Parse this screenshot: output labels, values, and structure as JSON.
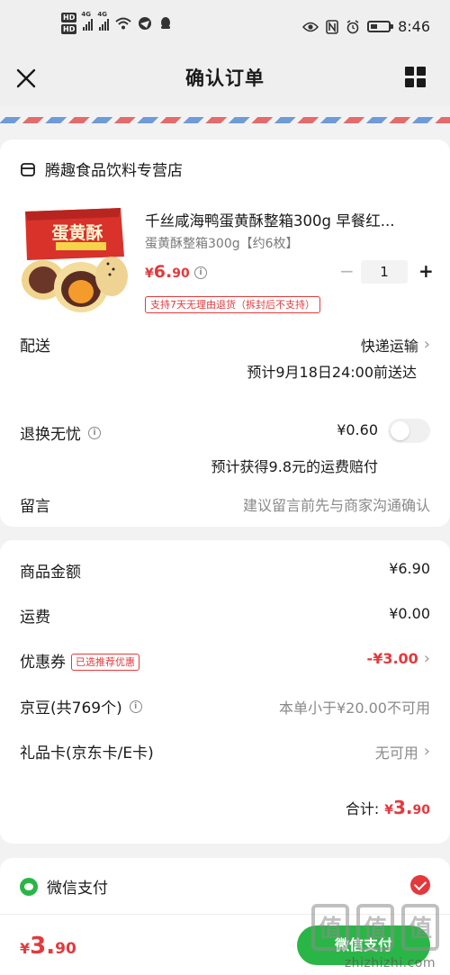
{
  "status_bar": {
    "left_labels": [
      "HD",
      "HD",
      "4G",
      "4G"
    ],
    "time": "8:46"
  },
  "header": {
    "title": "确认订单"
  },
  "store": {
    "name": "腾趣食品饮料专营店"
  },
  "product": {
    "title": "千丝咸海鸭蛋黄酥整箱300g 早餐红...",
    "spec": "蛋黄酥整箱300g【约6枚】",
    "price_currency": "¥",
    "price_int": "6.",
    "price_dec": "90",
    "quantity": "1",
    "return_policy": "支持7天无理由退货（拆封后不支持）",
    "box_label": "蛋黄酥"
  },
  "delivery": {
    "label": "配送",
    "method": "快递运输",
    "eta": "预计9月18日24:00前送达"
  },
  "return_worry": {
    "label": "退换无忧",
    "price": "¥0.60",
    "note": "预计获得9.8元的运费赔付",
    "enabled": false
  },
  "message": {
    "label": "留言",
    "placeholder": "建议留言前先与商家沟通确认"
  },
  "summary": {
    "goods_label": "商品金额",
    "goods_value": "¥6.90",
    "shipping_label": "运费",
    "shipping_value": "¥0.00",
    "coupon_label": "优惠券",
    "coupon_tag": "已选推荐优惠",
    "coupon_value": "-¥3.00",
    "jd_beans_label": "京豆(共769个)",
    "jd_beans_value": "本单小于¥20.00不可用",
    "gift_card_label": "礼品卡(京东卡/E卡)",
    "gift_card_value": "无可用",
    "total_label": "合计:",
    "total_currency": "¥",
    "total_int": "3.",
    "total_dec": "90"
  },
  "payment": {
    "method": "微信支付",
    "selected": true
  },
  "bottom": {
    "currency": "¥",
    "price_int": "3.",
    "price_dec": "90",
    "pay_button": "微信支付"
  },
  "watermark": {
    "logo": "值",
    "site": "zhizhizhi.com"
  },
  "colors": {
    "accent_red": "#e4393c",
    "wechat_green": "#2ab647",
    "background": "#f2f2f2"
  }
}
